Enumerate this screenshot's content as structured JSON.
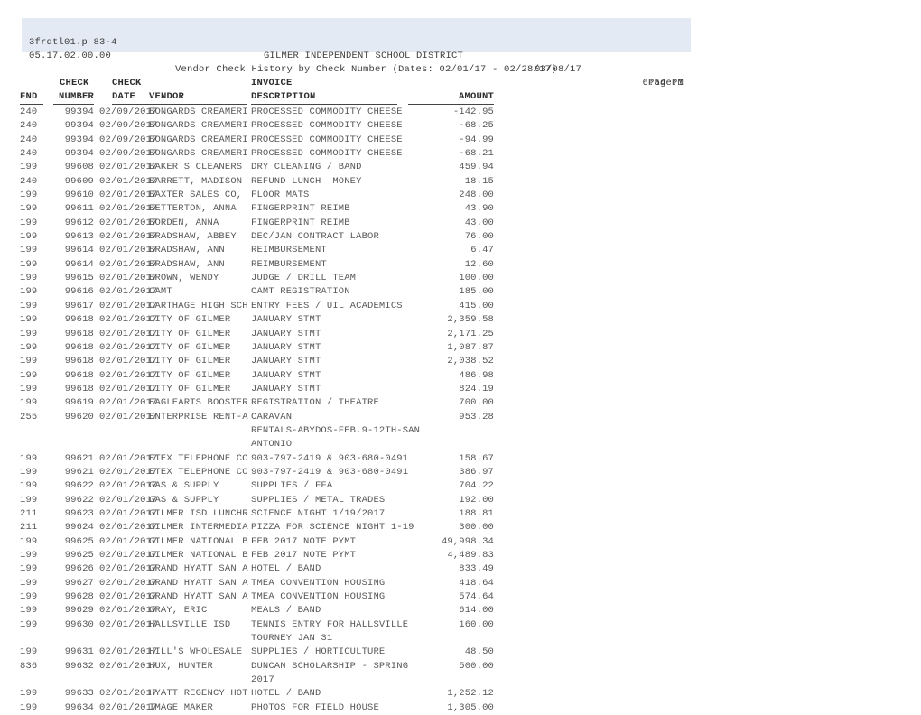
{
  "report_header": {
    "program_id": "3frdtl01.p 83-4",
    "version": "05.17.02.00.00",
    "district_title": "GILMER INDEPENDENT SCHOOL DISTRICT",
    "report_title": "Vendor Check History by Check Number (Dates: 02/01/17 - 02/28/17)",
    "run_date": "03/08/17",
    "page_label": "Page:1",
    "run_time": "6:54 PM",
    "banner_color": "#e3eaf4"
  },
  "column_headers": {
    "check_top": "CHECK",
    "check_date_top": "CHECK",
    "invoice_top": "INVOICE",
    "fnd": "FND",
    "number": "NUMBER",
    "date": "DATE",
    "vendor": "VENDOR",
    "description": "DESCRIPTION",
    "amount": "AMOUNT"
  },
  "rows": [
    {
      "fnd": "240",
      "number": "99394",
      "date": "02/09/2017",
      "vendor": "BONGARDS CREAMERIES",
      "description": "PROCESSED COMMODITY CHEESE",
      "amount": "-142.95"
    },
    {
      "fnd": "240",
      "number": "99394",
      "date": "02/09/2017",
      "vendor": "BONGARDS CREAMERIES",
      "description": "PROCESSED COMMODITY CHEESE",
      "amount": "-68.25"
    },
    {
      "fnd": "240",
      "number": "99394",
      "date": "02/09/2017",
      "vendor": "BONGARDS CREAMERIES",
      "description": "PROCESSED COMMODITY CHEESE",
      "amount": "-94.99"
    },
    {
      "fnd": "240",
      "number": "99394",
      "date": "02/09/2017",
      "vendor": "BONGARDS CREAMERIES",
      "description": "PROCESSED COMMODITY CHEESE",
      "amount": "-68.21"
    },
    {
      "fnd": "199",
      "number": "99608",
      "date": "02/01/2017",
      "vendor": "BAKER'S CLEANERS",
      "description": "DRY CLEANING / BAND",
      "amount": "459.94"
    },
    {
      "fnd": "240",
      "number": "99609",
      "date": "02/01/2017",
      "vendor": "BARRETT, MADISON",
      "description": "REFUND LUNCH  MONEY",
      "amount": "18.15"
    },
    {
      "fnd": "199",
      "number": "99610",
      "date": "02/01/2017",
      "vendor": "BAXTER SALES CO, INC",
      "description": "FLOOR MATS",
      "amount": "248.00"
    },
    {
      "fnd": "199",
      "number": "99611",
      "date": "02/01/2017",
      "vendor": "BETTERTON, ANNA",
      "description": "FINGERPRINT REIMB",
      "amount": "43.90"
    },
    {
      "fnd": "199",
      "number": "99612",
      "date": "02/01/2017",
      "vendor": "BORDEN, ANNA",
      "description": "FINGERPRINT REIMB",
      "amount": "43.00"
    },
    {
      "fnd": "199",
      "number": "99613",
      "date": "02/01/2017",
      "vendor": "BRADSHAW, ABBEY",
      "description": "DEC/JAN CONTRACT LABOR",
      "amount": "76.00"
    },
    {
      "fnd": "199",
      "number": "99614",
      "date": "02/01/2017",
      "vendor": "BRADSHAW, ANN",
      "description": "REIMBURSEMENT",
      "amount": "6.47"
    },
    {
      "fnd": "199",
      "number": "99614",
      "date": "02/01/2017",
      "vendor": "BRADSHAW, ANN",
      "description": "REIMBURSEMENT",
      "amount": "12.60"
    },
    {
      "fnd": "199",
      "number": "99615",
      "date": "02/01/2017",
      "vendor": "BROWN, WENDY",
      "description": "JUDGE / DRILL TEAM",
      "amount": "100.00"
    },
    {
      "fnd": "199",
      "number": "99616",
      "date": "02/01/2017",
      "vendor": "CAMT",
      "description": "CAMT REGISTRATION",
      "amount": "185.00"
    },
    {
      "fnd": "199",
      "number": "99617",
      "date": "02/01/2017",
      "vendor": "CARTHAGE HIGH SCHOOL",
      "description": "ENTRY FEES / UIL ACADEMICS",
      "amount": "415.00"
    },
    {
      "fnd": "199",
      "number": "99618",
      "date": "02/01/2017",
      "vendor": "CITY OF GILMER",
      "description": "JANUARY STMT",
      "amount": "2,359.58"
    },
    {
      "fnd": "199",
      "number": "99618",
      "date": "02/01/2017",
      "vendor": "CITY OF GILMER",
      "description": "JANUARY STMT",
      "amount": "2,171.25"
    },
    {
      "fnd": "199",
      "number": "99618",
      "date": "02/01/2017",
      "vendor": "CITY OF GILMER",
      "description": "JANUARY STMT",
      "amount": "1,087.87"
    },
    {
      "fnd": "199",
      "number": "99618",
      "date": "02/01/2017",
      "vendor": "CITY OF GILMER",
      "description": "JANUARY STMT",
      "amount": "2,038.52"
    },
    {
      "fnd": "199",
      "number": "99618",
      "date": "02/01/2017",
      "vendor": "CITY OF GILMER",
      "description": "JANUARY STMT",
      "amount": "486.98"
    },
    {
      "fnd": "199",
      "number": "99618",
      "date": "02/01/2017",
      "vendor": "CITY OF GILMER",
      "description": "JANUARY STMT",
      "amount": "824.19"
    },
    {
      "fnd": "199",
      "number": "99619",
      "date": "02/01/2017",
      "vendor": "EAGLEARTS BOOSTERS",
      "description": "REGISTRATION / THEATRE",
      "amount": "700.00"
    },
    {
      "fnd": "255",
      "number": "99620",
      "date": "02/01/2017",
      "vendor": "ENTERPRISE RENT-A-CA",
      "description": "CARAVAN",
      "amount": "953.28"
    },
    {
      "fnd": "",
      "number": "",
      "date": "",
      "vendor": "",
      "description": "RENTALS-ABYDOS-FEB.9-12TH-SAN",
      "amount": "",
      "continuation": true
    },
    {
      "fnd": "",
      "number": "",
      "date": "",
      "vendor": "",
      "description": "ANTONIO",
      "amount": "",
      "continuation": true
    },
    {
      "fnd": "199",
      "number": "99621",
      "date": "02/01/2017",
      "vendor": "ETEX TELEPHONE COOP,",
      "description": "903-797-2419 & 903-680-0491",
      "amount": "158.67"
    },
    {
      "fnd": "199",
      "number": "99621",
      "date": "02/01/2017",
      "vendor": "ETEX TELEPHONE COOP,",
      "description": "903-797-2419 & 903-680-0491",
      "amount": "386.97"
    },
    {
      "fnd": "199",
      "number": "99622",
      "date": "02/01/2017",
      "vendor": "GAS & SUPPLY",
      "description": "SUPPLIES / FFA",
      "amount": "704.22"
    },
    {
      "fnd": "199",
      "number": "99622",
      "date": "02/01/2017",
      "vendor": "GAS & SUPPLY",
      "description": "SUPPLIES / METAL TRADES",
      "amount": "192.00"
    },
    {
      "fnd": "211",
      "number": "99623",
      "date": "02/01/2017",
      "vendor": "GILMER ISD LUNCHROOM",
      "description": "SCIENCE NIGHT 1/19/2017",
      "amount": "188.81"
    },
    {
      "fnd": "211",
      "number": "99624",
      "date": "02/01/2017",
      "vendor": "GILMER INTERMEDIATE",
      "description": "PIZZA FOR SCIENCE NIGHT 1-19",
      "amount": "300.00"
    },
    {
      "fnd": "199",
      "number": "99625",
      "date": "02/01/2017",
      "vendor": "GILMER NATIONAL BANK",
      "description": "FEB 2017 NOTE PYMT",
      "amount": "49,998.34"
    },
    {
      "fnd": "199",
      "number": "99625",
      "date": "02/01/2017",
      "vendor": "GILMER NATIONAL BANK",
      "description": "FEB 2017 NOTE PYMT",
      "amount": "4,489.83"
    },
    {
      "fnd": "199",
      "number": "99626",
      "date": "02/01/2017",
      "vendor": "GRAND HYATT SAN ANTO",
      "description": "HOTEL / BAND",
      "amount": "833.49"
    },
    {
      "fnd": "199",
      "number": "99627",
      "date": "02/01/2017",
      "vendor": "GRAND HYATT SAN ANTO",
      "description": "TMEA CONVENTION HOUSING",
      "amount": "418.64"
    },
    {
      "fnd": "199",
      "number": "99628",
      "date": "02/01/2017",
      "vendor": "GRAND HYATT SAN ANTO",
      "description": "TMEA CONVENTION HOUSING",
      "amount": "574.64"
    },
    {
      "fnd": "199",
      "number": "99629",
      "date": "02/01/2017",
      "vendor": "GRAY, ERIC",
      "description": "MEALS / BAND",
      "amount": "614.00"
    },
    {
      "fnd": "199",
      "number": "99630",
      "date": "02/01/2017",
      "vendor": "HALLSVILLE ISD",
      "description": "TENNIS ENTRY FOR HALLSVILLE",
      "amount": "160.00"
    },
    {
      "fnd": "",
      "number": "",
      "date": "",
      "vendor": "",
      "description": "TOURNEY JAN 31",
      "amount": "",
      "continuation": true
    },
    {
      "fnd": "199",
      "number": "99631",
      "date": "02/01/2017",
      "vendor": "HILL'S WHOLESALE FLO",
      "description": "SUPPLIES / HORTICULTURE",
      "amount": "48.50"
    },
    {
      "fnd": "836",
      "number": "99632",
      "date": "02/01/2017",
      "vendor": "HUX, HUNTER",
      "description": "DUNCAN SCHOLARSHIP - SPRING",
      "amount": "500.00"
    },
    {
      "fnd": "",
      "number": "",
      "date": "",
      "vendor": "",
      "description": "2017",
      "amount": "",
      "continuation": true
    },
    {
      "fnd": "199",
      "number": "99633",
      "date": "02/01/2017",
      "vendor": "HYATT REGENCY HOTEL-",
      "description": "HOTEL / BAND",
      "amount": "1,252.12"
    },
    {
      "fnd": "199",
      "number": "99634",
      "date": "02/01/2017",
      "vendor": "IMAGE MAKER",
      "description": "PHOTOS FOR FIELD HOUSE",
      "amount": "1,305.00"
    }
  ]
}
